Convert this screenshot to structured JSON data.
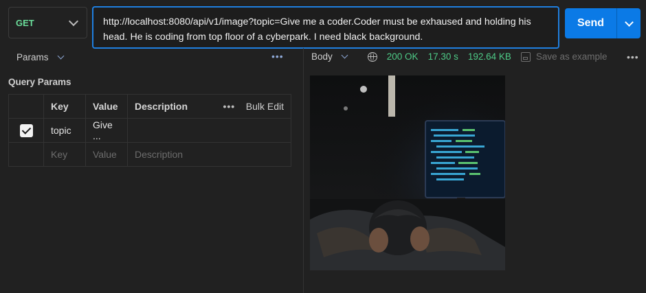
{
  "request": {
    "method": "GET",
    "url": "http://localhost:8080/api/v1/image?topic=Give me a coder.Coder must be exhaused and holding his head. He is coding from top floor of a cyberpark. I need black background.",
    "send_label": "Send"
  },
  "params_tab": {
    "label": "Params"
  },
  "query_params": {
    "title": "Query Params",
    "headers": {
      "key": "Key",
      "value": "Value",
      "description": "Description",
      "bulk_edit": "Bulk Edit"
    },
    "rows": [
      {
        "checked": true,
        "key": "topic",
        "value": "Give ...",
        "description": ""
      }
    ],
    "placeholder": {
      "key": "Key",
      "value": "Value",
      "description": "Description"
    }
  },
  "response": {
    "tab_label": "Body",
    "status": "200 OK",
    "time": "17.30 s",
    "size": "192.64 KB",
    "save_label": "Save as example"
  },
  "colors": {
    "accent": "#0b7ae6",
    "method_get": "#6bdd9a",
    "status_ok": "#4ecb87",
    "background": "#212121"
  }
}
